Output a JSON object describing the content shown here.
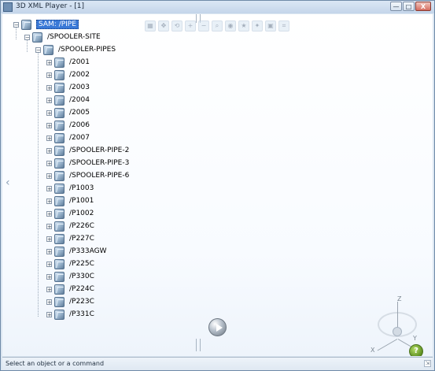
{
  "window": {
    "title": "3D XML Player - [1]",
    "buttons": {
      "minimize": "—",
      "maximize": "□",
      "close": "X"
    }
  },
  "toolbar": {
    "items": [
      {
        "icon": "fit-all-icon"
      },
      {
        "icon": "pan-icon"
      },
      {
        "icon": "rotate-icon"
      },
      {
        "icon": "zoom-in-icon"
      },
      {
        "icon": "zoom-out-icon"
      },
      {
        "icon": "zoom-area-icon"
      },
      {
        "icon": "normal-view-icon"
      },
      {
        "icon": "multi-view-icon"
      },
      {
        "icon": "materials-icon"
      },
      {
        "icon": "section-icon"
      },
      {
        "icon": "measure-icon"
      }
    ]
  },
  "tree": {
    "root": {
      "label": "SAM: /PIPE",
      "selected": true
    },
    "nodes": [
      {
        "label": "/SPOOLER-SITE",
        "level": 1
      },
      {
        "label": "/SPOOLER-PIPES",
        "level": 2
      },
      {
        "label": "/2001",
        "level": 3
      },
      {
        "label": "/2002",
        "level": 3
      },
      {
        "label": "/2003",
        "level": 3
      },
      {
        "label": "/2004",
        "level": 3
      },
      {
        "label": "/2005",
        "level": 3
      },
      {
        "label": "/2006",
        "level": 3
      },
      {
        "label": "/2007",
        "level": 3
      },
      {
        "label": "/SPOOLER-PIPE-2",
        "level": 3
      },
      {
        "label": "/SPOOLER-PIPE-3",
        "level": 3
      },
      {
        "label": "/SPOOLER-PIPE-6",
        "level": 3
      },
      {
        "label": "/P1003",
        "level": 3
      },
      {
        "label": "/P1001",
        "level": 3
      },
      {
        "label": "/P1002",
        "level": 3
      },
      {
        "label": "/P226C",
        "level": 3
      },
      {
        "label": "/P227C",
        "level": 3
      },
      {
        "label": "/P333AGW",
        "level": 3
      },
      {
        "label": "/P225C",
        "level": 3
      },
      {
        "label": "/P330C",
        "level": 3
      },
      {
        "label": "/P224C",
        "level": 3
      },
      {
        "label": "/P223C",
        "level": 3
      },
      {
        "label": "/P331C",
        "level": 3
      }
    ]
  },
  "compass": {
    "axes": {
      "x": "X",
      "y": "Y",
      "z": "Z"
    },
    "badge": "?"
  },
  "status": {
    "text": "Select an object or a command"
  },
  "colors": {
    "selection": "#3a79d7",
    "window_frame": "#6f8aa8"
  }
}
